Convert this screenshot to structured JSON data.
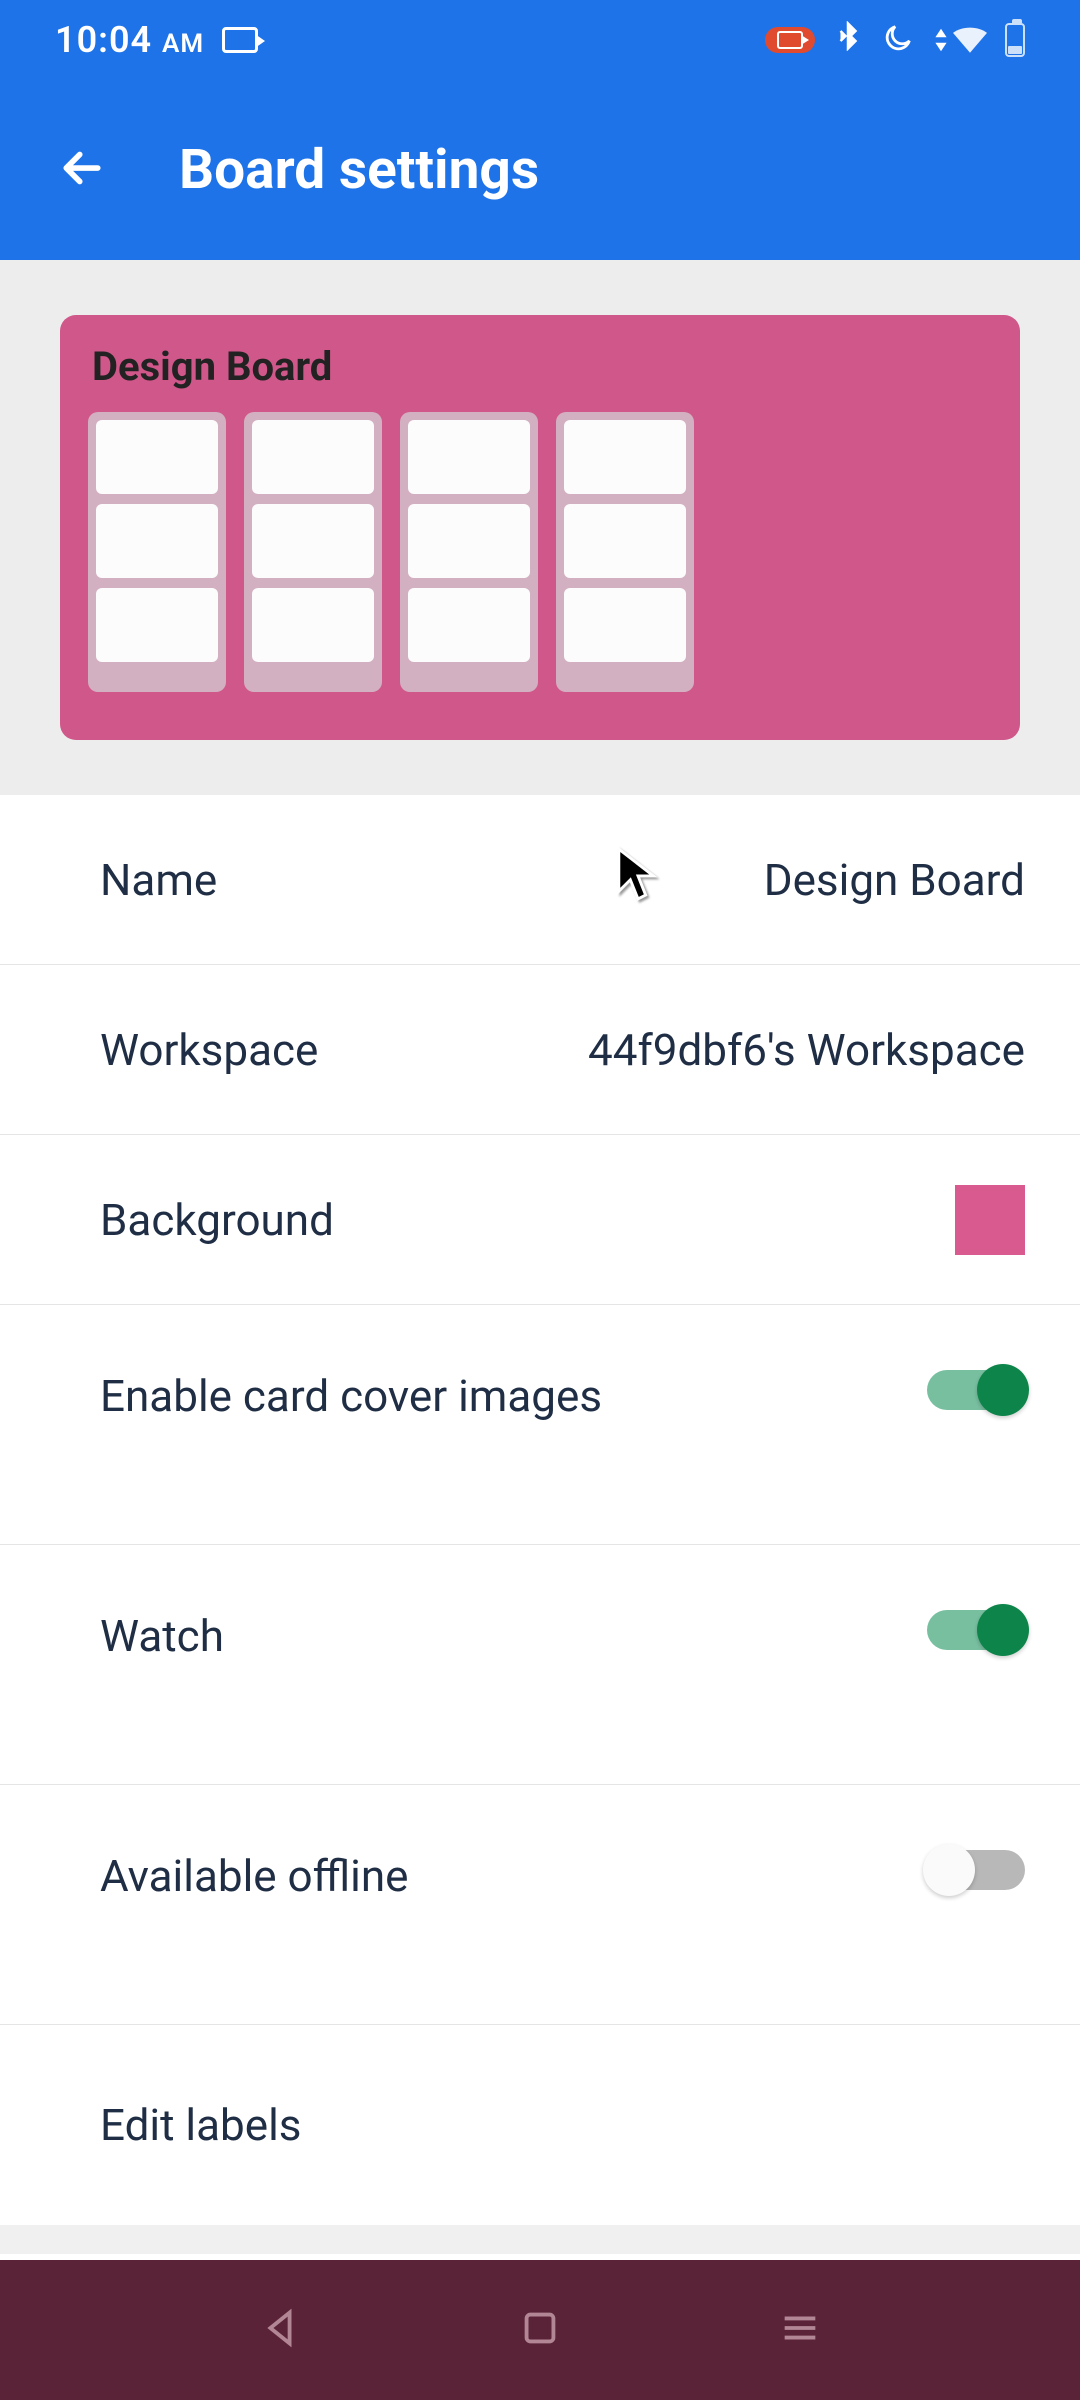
{
  "status_bar": {
    "time": "10:04",
    "ampm": "AM"
  },
  "app_bar": {
    "title": "Board settings"
  },
  "board_preview": {
    "title": "Design Board",
    "background_color": "#d0578a",
    "list_count": 4,
    "cards_per_list": 3
  },
  "settings": {
    "name": {
      "label": "Name",
      "value": "Design Board"
    },
    "workspace": {
      "label": "Workspace",
      "value": "44f9dbf6's Workspace"
    },
    "background": {
      "label": "Background",
      "color": "#d85a8f"
    },
    "enable_card_cover": {
      "label": "Enable card cover images",
      "on": true
    },
    "watch": {
      "label": "Watch",
      "on": true
    },
    "available_offline": {
      "label": "Available offline",
      "on": false
    },
    "edit_labels": {
      "label": "Edit labels"
    }
  },
  "colors": {
    "primary_blue": "#1e73e8",
    "board_pink": "#d0578a",
    "toggle_on_track": "#78bfa0",
    "toggle_on_knob": "#0d854a",
    "nav_maroon": "#5a2338"
  }
}
